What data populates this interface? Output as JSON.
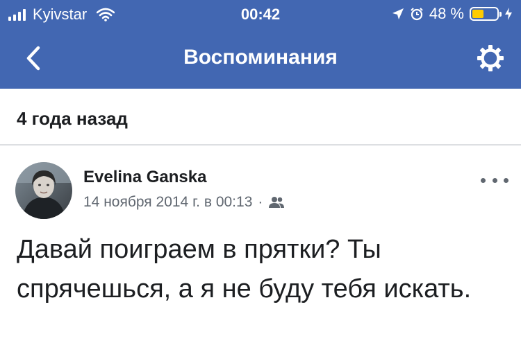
{
  "status_bar": {
    "carrier": "Kyivstar",
    "time": "00:42",
    "battery_percent": "48 %",
    "battery_level": 0.48,
    "icons": [
      "signal-icon",
      "wifi-icon",
      "location-arrow-icon",
      "alarm-icon",
      "battery-icon",
      "charging-bolt-icon"
    ]
  },
  "nav": {
    "title": "Воспоминания",
    "back_icon": "chevron-left-icon",
    "settings_icon": "gear-icon"
  },
  "section": {
    "title": "4 года назад"
  },
  "post": {
    "author": "Evelina Ganska",
    "date": "14 ноября 2014 г. в 00:13",
    "separator": "·",
    "audience_icon": "friends-icon",
    "text": "Давай поиграем в прятки? Ты спрячешься, а я не буду тебя искать."
  },
  "colors": {
    "header": "#4267b2",
    "battery_fill": "#ffcc00",
    "meta_text": "#606770"
  }
}
